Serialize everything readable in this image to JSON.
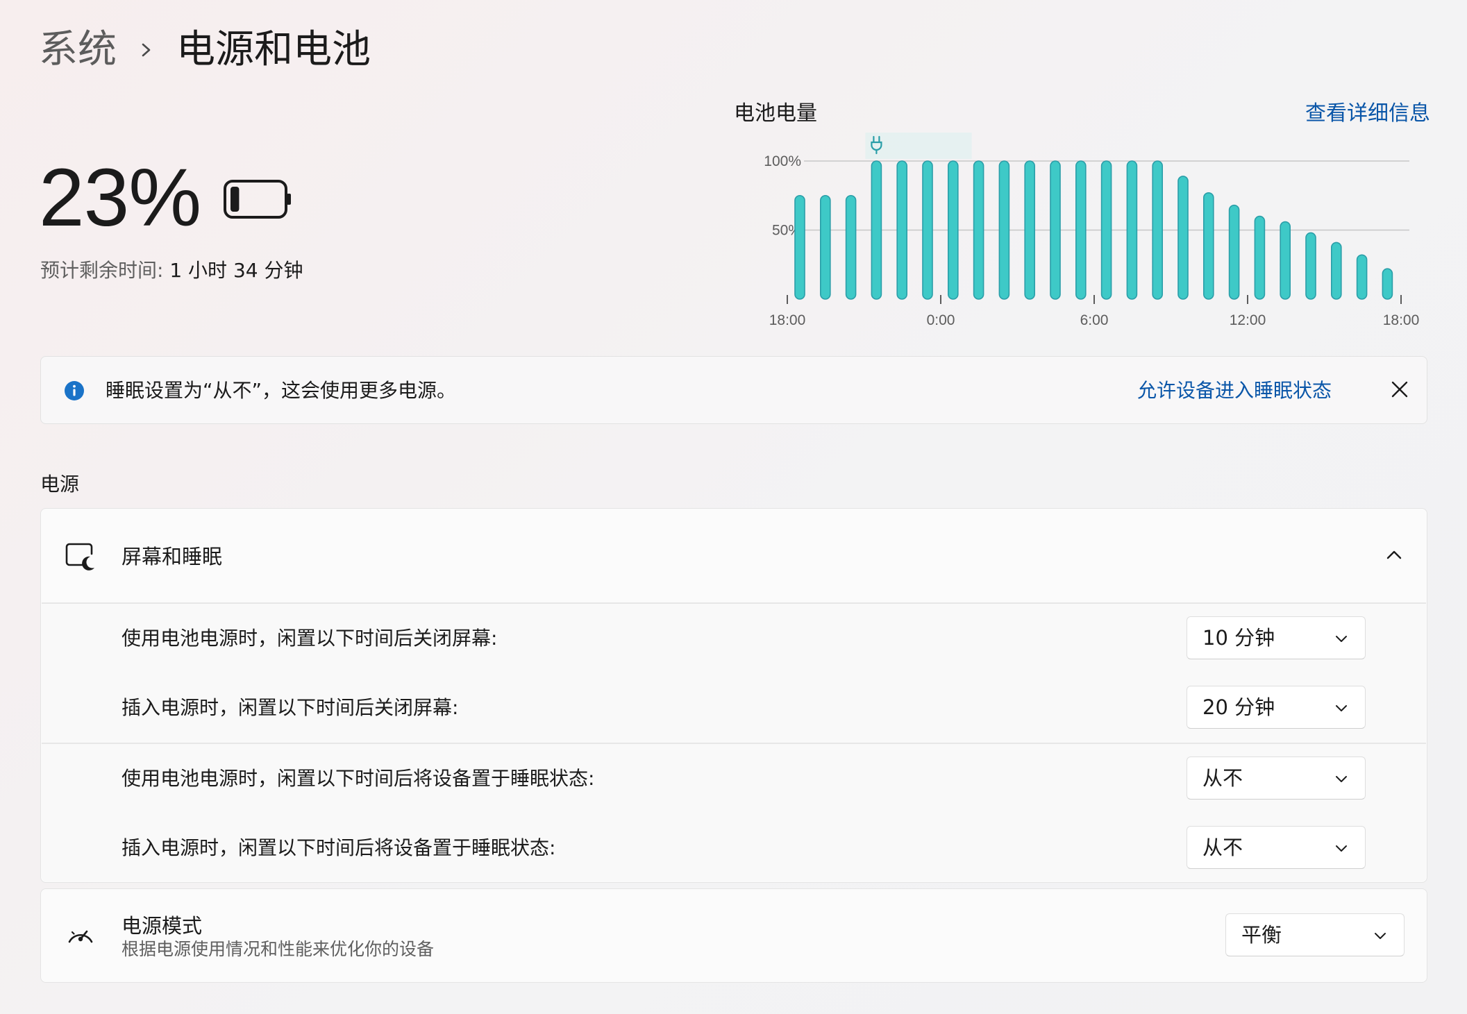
{
  "breadcrumb": {
    "parent": "系统",
    "separator": "›",
    "current": "电源和电池"
  },
  "battery": {
    "percent_label": "23%",
    "level_fraction": 0.23,
    "eta_label": "预计剩余时间: ",
    "eta_value": "1 小时 34 分钟"
  },
  "chart_header": {
    "title": "电池电量",
    "details_link": "查看详细信息"
  },
  "chart_data": {
    "type": "bar",
    "title": "电池电量",
    "y_ticks": [
      "100%",
      "50%"
    ],
    "y_tick_values": [
      100,
      50
    ],
    "ylim": [
      0,
      100
    ],
    "x_ticks": [
      "18:00",
      "0:00",
      "6:00",
      "12:00",
      "18:00"
    ],
    "values": [
      75,
      75,
      75,
      100,
      100,
      100,
      100,
      100,
      100,
      100,
      100,
      100,
      100,
      100,
      100,
      89,
      77,
      68,
      60,
      56,
      48,
      41,
      32,
      22
    ],
    "charging_marker_index": 3,
    "charging_span_bars": 4,
    "bar_color": "#3ec9c7",
    "bar_border": "#2a9ea8",
    "grid": true
  },
  "info_bar": {
    "message": "睡眠设置为“从不”，这会使用更多电源。",
    "action_link": "允许设备进入睡眠状态",
    "accent": "#1a73c8"
  },
  "power_section": {
    "label": "电源",
    "screen_sleep": {
      "title": "屏幕和睡眠",
      "settings": [
        {
          "label": "使用电池电源时，闲置以下时间后关闭屏幕:",
          "value": "10 分钟"
        },
        {
          "label": "插入电源时，闲置以下时间后关闭屏幕:",
          "value": "20 分钟"
        },
        {
          "label": "使用电池电源时，闲置以下时间后将设备置于睡眠状态:",
          "value": "从不"
        },
        {
          "label": "插入电源时，闲置以下时间后将设备置于睡眠状态:",
          "value": "从不"
        }
      ]
    },
    "power_mode": {
      "title": "电源模式",
      "description": "根据电源使用情况和性能来优化你的设备",
      "value": "平衡"
    }
  }
}
